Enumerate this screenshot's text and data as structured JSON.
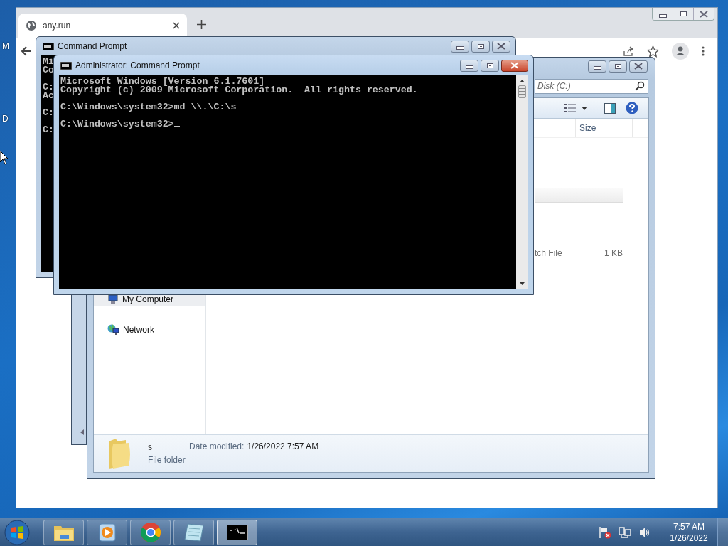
{
  "desktop": {
    "icon_labels": [
      "M",
      "D"
    ]
  },
  "browser": {
    "tab": {
      "title": "any.run"
    }
  },
  "explorer": {
    "search": {
      "placeholder": "Disk (C:)"
    },
    "columns": [
      "Size"
    ],
    "rows": [
      {
        "type": "tch File",
        "size": "1 KB"
      }
    ],
    "nav": [
      {
        "label": "My Computer",
        "selected": true
      },
      {
        "label": "Network",
        "selected": false
      }
    ],
    "details": {
      "name": "s",
      "type": "File folder",
      "date_label": "Date modified:",
      "date": "1/26/2022 7:57 AM"
    }
  },
  "back_console": {
    "title": "Command Prompt",
    "blocks": [
      [
        "Mi",
        "Co"
      ],
      [
        "C:",
        "Ac"
      ],
      [
        "C:"
      ],
      [
        "C:"
      ]
    ]
  },
  "console": {
    "title": "Administrator: Command Prompt",
    "cursor": true,
    "blocks": [
      [
        "Microsoft Windows [Version 6.1.7601]",
        "Copyright (c) 2009 Microsoft Corporation.  All rights reserved."
      ],
      [
        "C:\\Windows\\system32>md \\\\.\\C:\\s"
      ],
      [
        "C:\\Windows\\system32>"
      ]
    ]
  },
  "taskbar": {
    "apps": [
      {
        "kind": "explorer",
        "selected": false
      },
      {
        "kind": "media",
        "selected": false
      },
      {
        "kind": "chrome",
        "selected": false
      },
      {
        "kind": "notepad",
        "selected": false
      },
      {
        "kind": "cmd",
        "selected": true
      }
    ],
    "time": "7:57 AM",
    "date": "1/26/2022"
  }
}
